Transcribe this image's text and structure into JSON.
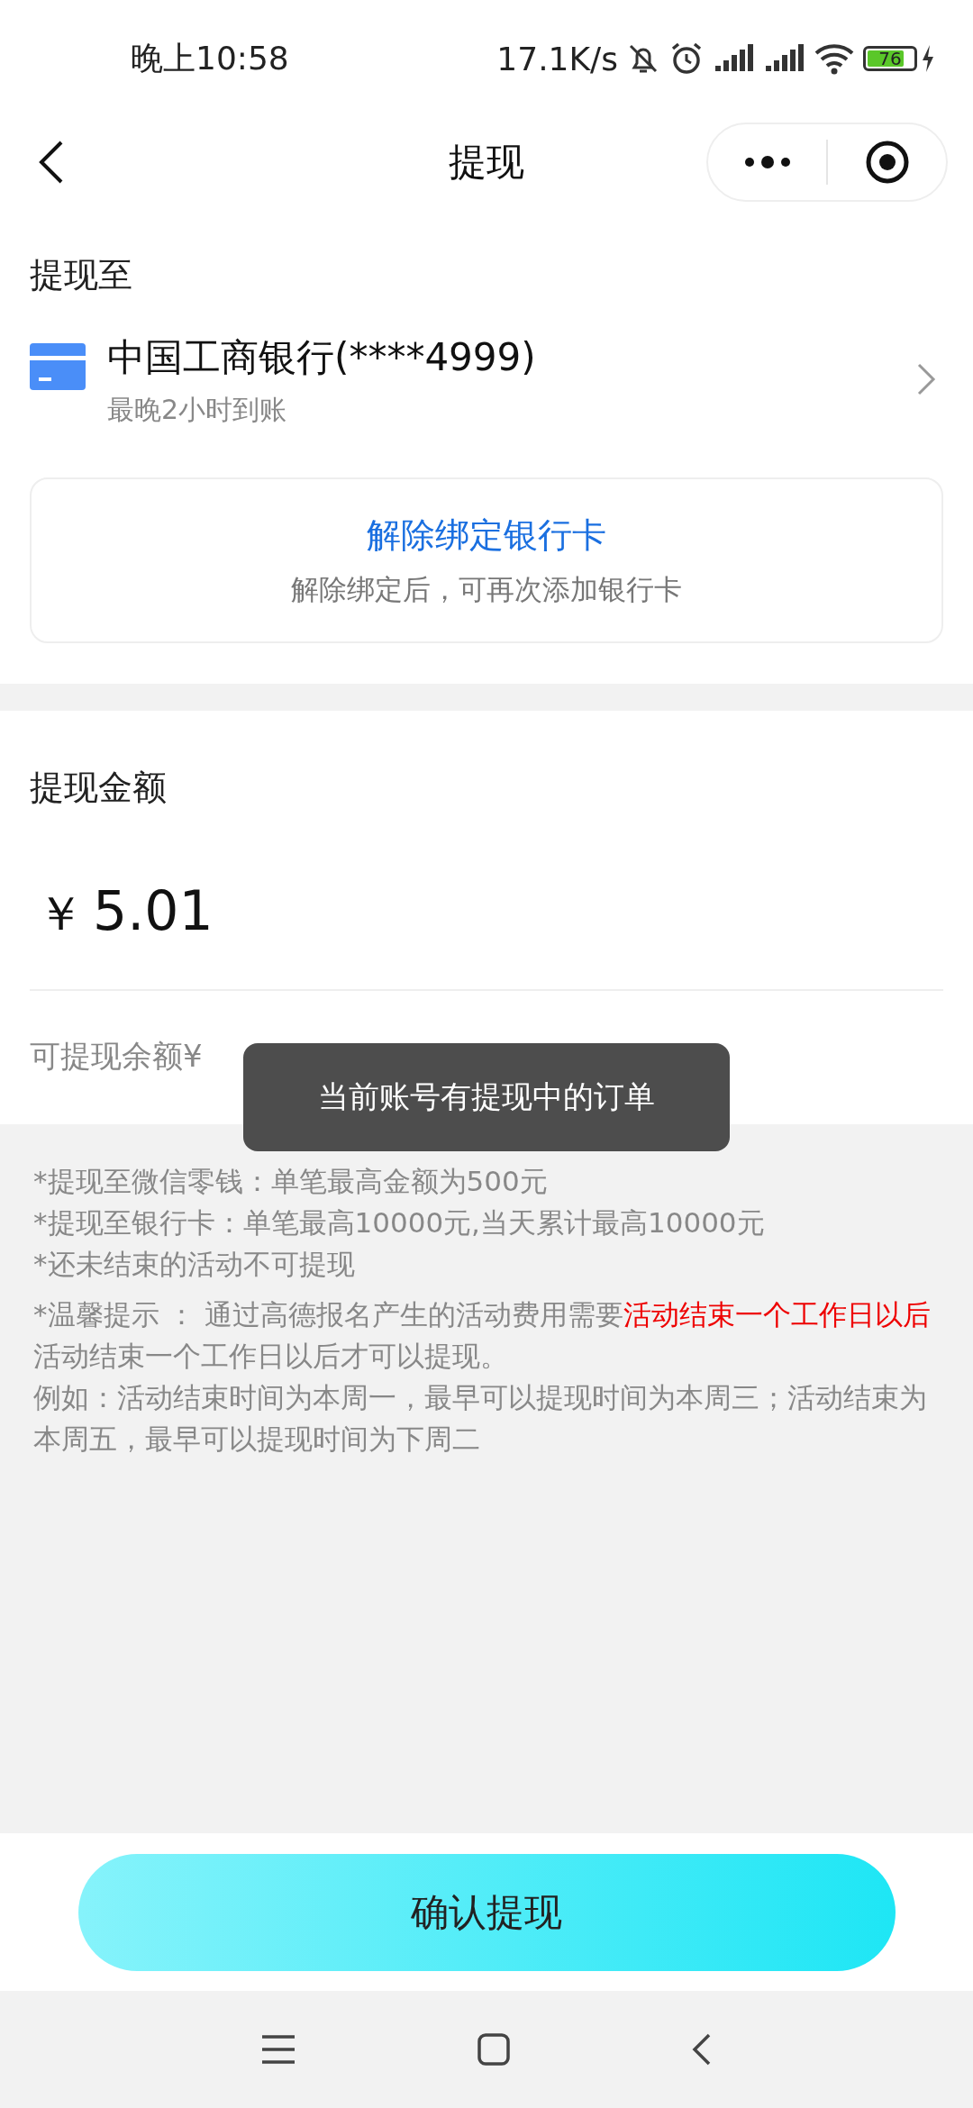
{
  "status_bar": {
    "time": "晚上10:58",
    "speed": "17.1K/s",
    "battery": "76"
  },
  "nav": {
    "title": "提现"
  },
  "destination": {
    "heading": "提现至",
    "bank": "中国工商银行(****4999)",
    "arrival": "最晚2小时到账",
    "unbind": {
      "label": "解除绑定银行卡",
      "hint": "解除绑定后，可再次添加银行卡"
    }
  },
  "amount": {
    "heading": "提现金额",
    "currency": "￥",
    "value": "5.01",
    "balance_label": "可提现余额¥"
  },
  "toast": "当前账号有提现中的订单",
  "notes": [
    {
      "kind": "line",
      "text": "*提现至微信零钱：单笔最高金额为500元"
    },
    {
      "kind": "line",
      "text": "*提现至银行卡：单笔最高10000元,当天累计最高10000元"
    },
    {
      "kind": "line",
      "text": "*还未结束的活动不可提现"
    },
    {
      "kind": "tip",
      "segments": [
        {
          "text": "*温馨提示 ： 通过高德报名产生的活动费用需要",
          "emphasis": false
        },
        {
          "text": "活动结束一个工作日以后",
          "emphasis": true
        },
        {
          "text": "活动结束一个工作日以后才可以提现。",
          "emphasis": false
        }
      ]
    },
    {
      "kind": "line",
      "text": "例如：活动结束时间为本周一，最早可以提现时间为本周三；活动结束为本周五，最早可以提现时间为下周二"
    }
  ],
  "confirm_button": "确认提现"
}
